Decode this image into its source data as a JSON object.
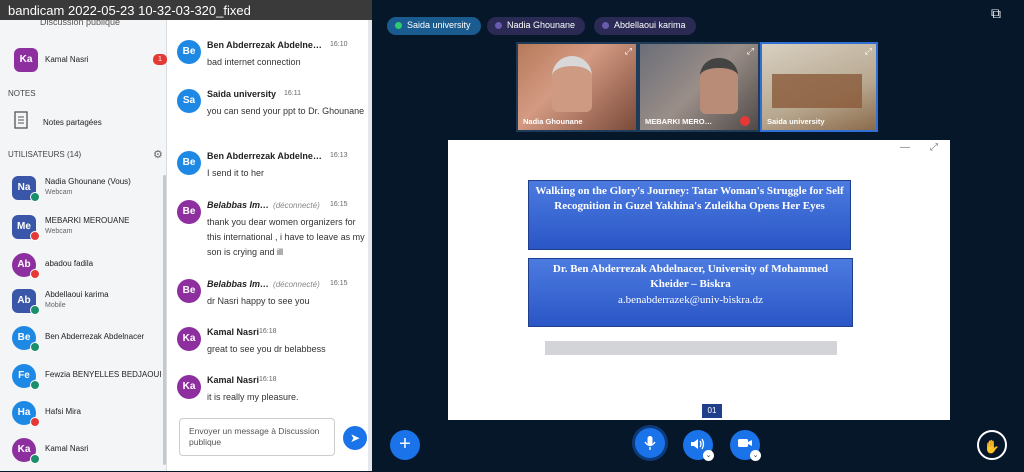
{
  "window": {
    "title": "bandicam 2022-05-23 10-32-03-320_fixed",
    "subtitle": "Discussion publique"
  },
  "sidebar": {
    "top_user": {
      "initials": "Ka",
      "name": "Kamal Nasri",
      "badge": "1"
    },
    "notes_label": "NOTES",
    "shared_notes": "Notes partagées",
    "users_label": "UTILISATEURS (14)",
    "users": [
      {
        "initials": "Na",
        "name": "Nadia Ghounane (Vous)",
        "sub": "Webcam",
        "color": "#3a56a8"
      },
      {
        "initials": "Me",
        "name": "MEBARKI MEROUANE",
        "sub": "Webcam",
        "color": "#3a56a8"
      },
      {
        "initials": "Ab",
        "name": "abadou fadila",
        "sub": "",
        "color": "#8e2fa0"
      },
      {
        "initials": "Ab",
        "name": "Abdellaoui karima",
        "sub": "Mobile",
        "color": "#3a56a8"
      },
      {
        "initials": "Be",
        "name": "Ben Abderrezak Abdelnacer",
        "sub": "",
        "color": "#1e88e5"
      },
      {
        "initials": "Fe",
        "name": "Fewzia BENYELLES BEDJAOUI",
        "sub": "",
        "color": "#1e88e5"
      },
      {
        "initials": "Ha",
        "name": "Hafsi Mira",
        "sub": "",
        "color": "#1e88e5"
      },
      {
        "initials": "Ka",
        "name": "Kamal Nasri",
        "sub": "",
        "color": "#8e2fa0"
      }
    ]
  },
  "chat": {
    "messages": [
      {
        "initials": "Be",
        "name": "Ben Abderrezak Abdelne…",
        "time": "16:10",
        "text": "bad internet connection",
        "color": "#1e88e5"
      },
      {
        "initials": "Sa",
        "name": "Saida university",
        "time": "16:11",
        "text": "you can send your ppt to Dr. Ghounane",
        "color": "#1e88e5"
      },
      {
        "initials": "Be",
        "name": "Ben Abderrezak Abdelne…",
        "time": "16:13",
        "text": "I send it to her",
        "color": "#1e88e5"
      },
      {
        "initials": "Be",
        "name": "Belabbas Im…",
        "disconnected": "(déconnecté)",
        "time": "16:15",
        "text": "thank you dear women organizers for this international , i have to leave as my son is crying and ill",
        "color": "#8e2fa0"
      },
      {
        "initials": "Be",
        "name": "Belabbas Im…",
        "disconnected": "(déconnecté)",
        "time": "16:15",
        "text": "dr Nasri happy to see you",
        "color": "#8e2fa0"
      },
      {
        "initials": "Ka",
        "name": "Kamal Nasri",
        "time": "16:18",
        "text": "great to see you dr belabbess",
        "color": "#8e2fa0"
      },
      {
        "initials": "Ka",
        "name": "Kamal Nasri",
        "time": "16:18",
        "text": "it is really my pleasure.",
        "color": "#8e2fa0"
      }
    ],
    "input_placeholder": "Envoyer un message à Discussion publique"
  },
  "presenters": [
    {
      "name": "Saida university",
      "color": "#1a8f6a"
    },
    {
      "name": "Nadia Ghounane",
      "color": "#3b2a5a"
    },
    {
      "name": "Abdellaoui karima",
      "color": "#3b2a5a"
    }
  ],
  "videos": [
    {
      "label": "Nadia Ghounane"
    },
    {
      "label": "MEBARKI MERO…"
    },
    {
      "label": "Saida university"
    }
  ],
  "slide": {
    "title": "Walking on the Glory's Journey: Tatar Woman's Struggle for Self Recognition in Guzel Yakhina's Zuleikha Opens Her Eyes",
    "author": "Dr. Ben Abderrezak Abdelnacer, University of Mohammed Kheider – Biskra",
    "email": "a.benabderrazek@univ-biskra.dz",
    "page": "01"
  }
}
